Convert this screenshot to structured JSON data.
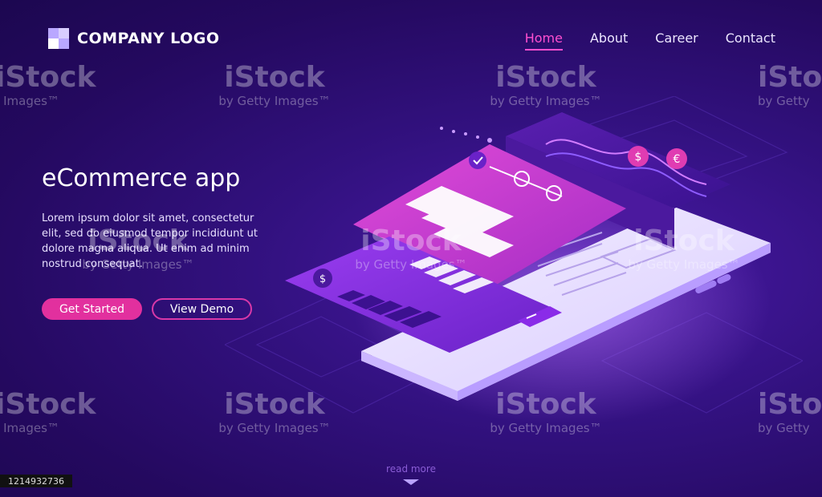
{
  "brand": {
    "logo_text": "COMPANY LOGO"
  },
  "nav": {
    "items": [
      {
        "label": "Home",
        "active": true
      },
      {
        "label": "About",
        "active": false
      },
      {
        "label": "Career",
        "active": false
      },
      {
        "label": "Contact",
        "active": false
      }
    ]
  },
  "hero": {
    "title": "eCommerce app",
    "body": "Lorem ipsum dolor sit amet, consectetur elit, sed do eiusmod tempor incididunt ut dolore magna aliqua. Ut enim ad minim nostrud consequat.",
    "primary_button": "Get Started",
    "secondary_button": "View Demo"
  },
  "footer": {
    "read_more": "read more"
  },
  "watermark": {
    "logo": "iStock",
    "credit": "by Getty Images™",
    "short_credit": "Images™",
    "edge_credit": "by Getty",
    "stock_id": "1214932736"
  },
  "illustration": {
    "currency_symbols": [
      "$",
      "€",
      "$",
      "$"
    ]
  },
  "colors": {
    "background": "#2a0c6e",
    "accent_pink": "#e2309e",
    "nav_active": "#ff4fd0",
    "card_pink": "#c936c9",
    "card_purple": "#8a2be8"
  }
}
